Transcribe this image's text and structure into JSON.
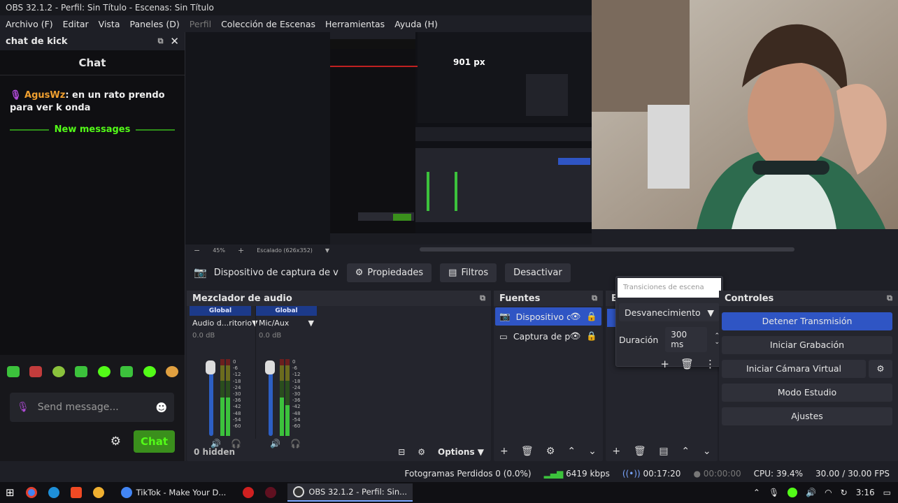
{
  "title_bar": {
    "text": "OBS 32.1.2 - Perfil: Sin Título - Escenas: Sin Título"
  },
  "menu": [
    "Archivo (F)",
    "Editar",
    "Vista",
    "Paneles (D)",
    "Perfil",
    "Colección de Escenas",
    "Herramientas",
    "Ayuda (H)"
  ],
  "chat_dock": {
    "title": "chat de kick",
    "chat_header": "Chat",
    "message": {
      "user": "AgusWz",
      "text": ": en un rato prendo para ver k onda"
    },
    "new_messages": "New messages",
    "input_placeholder": "Send message...",
    "send_label": "Chat"
  },
  "preview": {
    "nested_counter": "901 px",
    "zoom": "45%",
    "scaling": "Escalado (626x352)"
  },
  "source_toolbar": {
    "source_name": "Dispositivo de captura de v",
    "properties": "Propiedades",
    "filters": "Filtros",
    "deactivate": "Desactivar"
  },
  "mixer": {
    "title": "Mezclador de audio",
    "channels": [
      {
        "tag": "Global",
        "name": "Audio d...ritorio",
        "db": "0.0 dB"
      },
      {
        "tag": "Global",
        "name": "Mic/Aux",
        "db": "0.0 dB"
      }
    ],
    "ticks": [
      "0",
      "-6",
      "-12",
      "-18",
      "-24",
      "-30",
      "-36",
      "-42",
      "-48",
      "-54",
      "-60"
    ],
    "hidden": "0 hidden",
    "options": "Options"
  },
  "sources": {
    "title": "Fuentes",
    "items": [
      "Dispositivo c",
      "Captura de p"
    ]
  },
  "scenes": {
    "title_initial": "E"
  },
  "transitions": {
    "header": "Transiciones de escena",
    "selected": "Desvanecimiento",
    "duration_label": "Duración",
    "duration_value": "300 ms"
  },
  "controls": {
    "title": "Controles",
    "buttons": [
      "Detener Transmisión",
      "Iniciar Grabación",
      "Iniciar Cámara Virtual",
      "Modo Estudio",
      "Ajustes"
    ]
  },
  "status": {
    "dropped": "Fotogramas Perdidos 0 (0.0%)",
    "bitrate": "6419 kbps",
    "stream_time": "00:17:20",
    "rec_time": "00:00:00",
    "cpu": "CPU: 39.4%",
    "fps": "30.00 / 30.00 FPS"
  },
  "taskbar": {
    "apps": [
      "TikTok - Make Your D...",
      "OBS 32.1.2 - Perfil: Sin..."
    ],
    "time": "3:16"
  },
  "colors": {
    "accent": "#2f55c4",
    "kick_green": "#53fc18",
    "meter_green": "#3cc23c"
  }
}
